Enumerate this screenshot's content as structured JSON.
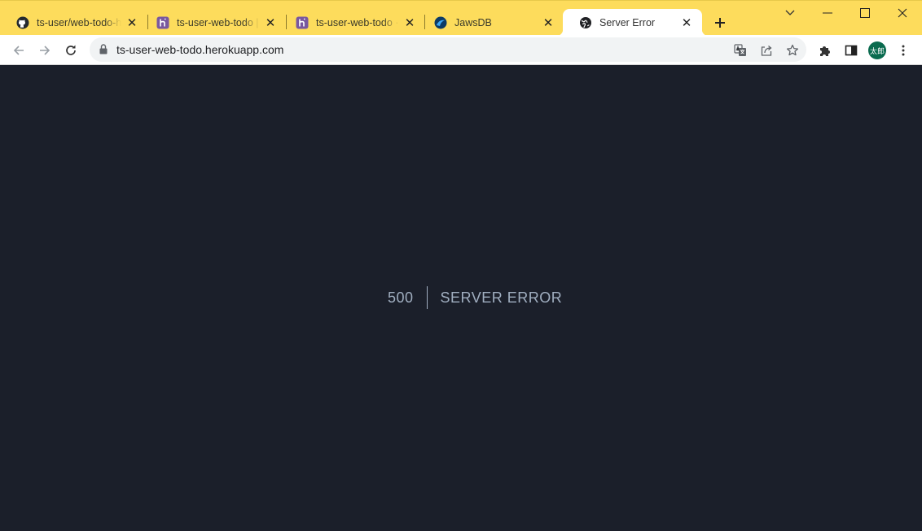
{
  "tabs": [
    {
      "title": "ts-user/web-todo-heroku",
      "favicon": "github-icon",
      "active": false
    },
    {
      "title": "ts-user-web-todo | Heroku",
      "favicon": "heroku-icon",
      "active": false
    },
    {
      "title": "ts-user-web-todo · Heroku",
      "favicon": "heroku-icon",
      "active": false
    },
    {
      "title": "JawsDB",
      "favicon": "jawsdb-icon",
      "active": false
    },
    {
      "title": "Server Error",
      "favicon": "globe-icon",
      "active": true
    }
  ],
  "address_bar": {
    "url": "ts-user-web-todo.herokuapp.com"
  },
  "profile": {
    "initials": "太郎"
  },
  "error_page": {
    "code": "500",
    "message": "SERVER ERROR"
  },
  "colors": {
    "tab_strip": "#fddc5c",
    "page_bg": "#1b1f2a",
    "error_text": "#a0aec0"
  }
}
